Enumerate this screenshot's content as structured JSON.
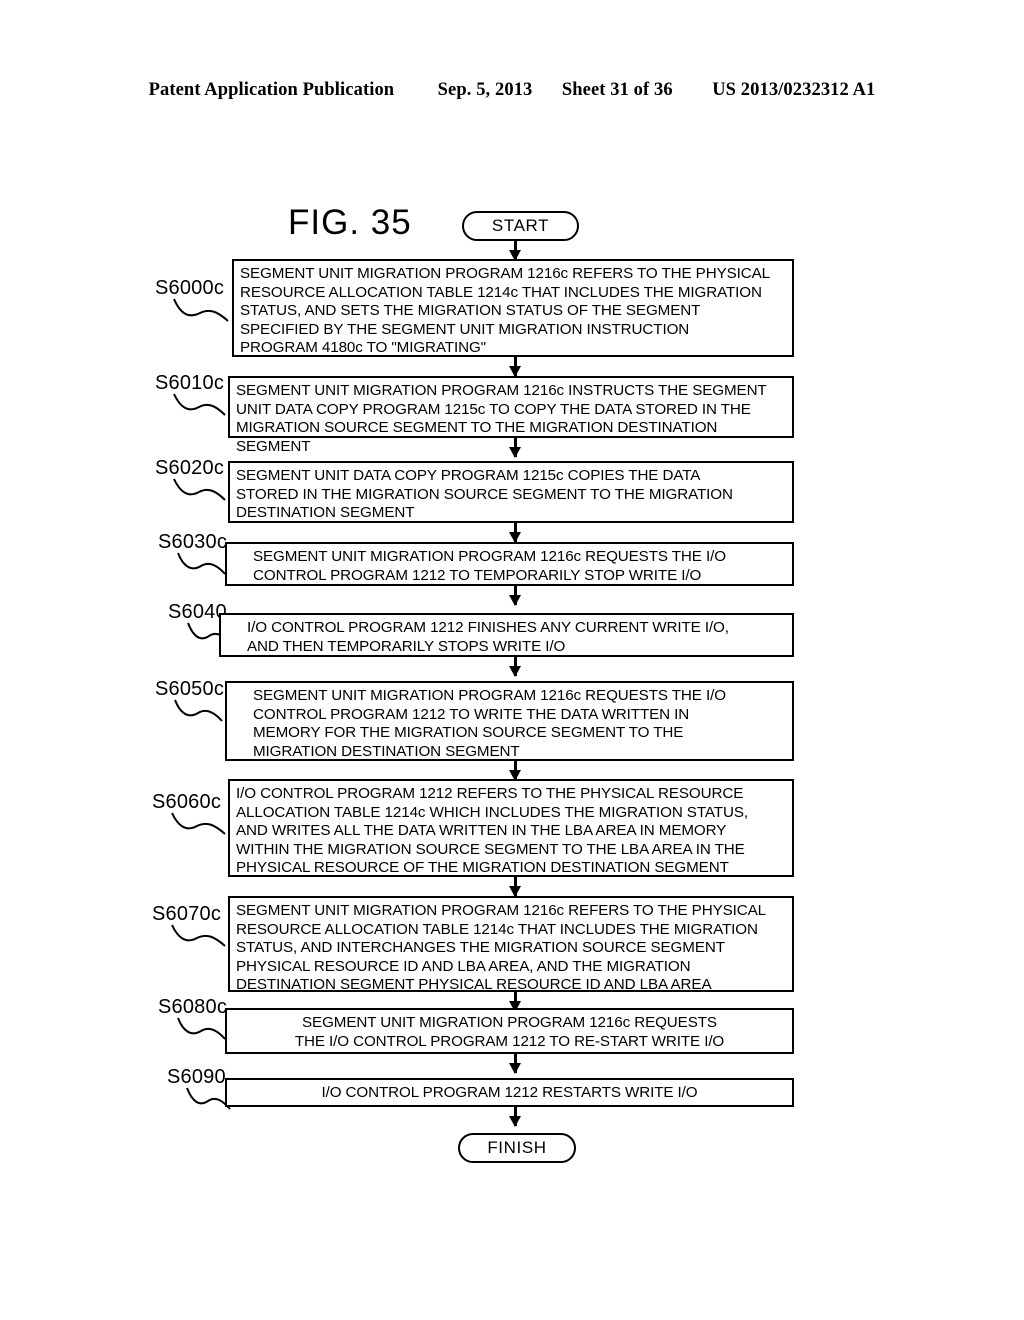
{
  "header": {
    "publication": "Patent Application Publication",
    "date": "Sep. 5, 2013",
    "sheet": "Sheet 31 of 36",
    "number": "US 2013/0232312 A1"
  },
  "figure": {
    "title": "FIG. 35"
  },
  "flow": {
    "start_label": "START",
    "finish_label": "FINISH",
    "steps": [
      {
        "id": "S6000c",
        "text": "SEGMENT UNIT MIGRATION PROGRAM 1216c REFERS TO THE PHYSICAL\nRESOURCE ALLOCATION TABLE 1214c THAT INCLUDES THE MIGRATION\nSTATUS, AND SETS THE MIGRATION STATUS OF THE SEGMENT\nSPECIFIED BY THE SEGMENT UNIT MIGRATION INSTRUCTION\nPROGRAM 4180c TO \"MIGRATING\""
      },
      {
        "id": "S6010c",
        "text": "SEGMENT UNIT MIGRATION PROGRAM 1216c INSTRUCTS THE SEGMENT\nUNIT DATA COPY PROGRAM 1215c TO COPY THE DATA STORED IN THE\nMIGRATION SOURCE SEGMENT TO THE MIGRATION DESTINATION SEGMENT"
      },
      {
        "id": "S6020c",
        "text": "SEGMENT UNIT DATA COPY PROGRAM 1215c COPIES THE DATA\nSTORED IN THE MIGRATION SOURCE SEGMENT TO THE MIGRATION\nDESTINATION SEGMENT"
      },
      {
        "id": "S6030c",
        "text": "SEGMENT UNIT MIGRATION PROGRAM 1216c REQUESTS THE I/O\nCONTROL PROGRAM 1212 TO TEMPORARILY STOP WRITE I/O"
      },
      {
        "id": "S6040",
        "text": "I/O CONTROL PROGRAM 1212 FINISHES ANY CURRENT WRITE I/O,\nAND THEN TEMPORARILY STOPS WRITE I/O"
      },
      {
        "id": "S6050c",
        "text": "SEGMENT UNIT MIGRATION PROGRAM 1216c REQUESTS THE I/O\nCONTROL PROGRAM 1212 TO WRITE THE DATA WRITTEN IN\nMEMORY FOR THE MIGRATION SOURCE SEGMENT TO THE\nMIGRATION DESTINATION SEGMENT"
      },
      {
        "id": "S6060c",
        "text": "I/O CONTROL PROGRAM 1212 REFERS TO THE PHYSICAL RESOURCE\nALLOCATION TABLE 1214c WHICH INCLUDES THE MIGRATION STATUS,\nAND WRITES ALL THE DATA WRITTEN IN THE LBA AREA IN MEMORY\nWITHIN THE MIGRATION SOURCE SEGMENT TO THE LBA AREA IN THE\nPHYSICAL RESOURCE OF THE MIGRATION DESTINATION SEGMENT"
      },
      {
        "id": "S6070c",
        "text": "SEGMENT UNIT MIGRATION PROGRAM 1216c REFERS TO THE PHYSICAL\nRESOURCE ALLOCATION TABLE 1214c THAT INCLUDES THE MIGRATION\nSTATUS, AND INTERCHANGES THE MIGRATION SOURCE SEGMENT\nPHYSICAL RESOURCE ID AND LBA AREA, AND THE MIGRATION\nDESTINATION SEGMENT PHYSICAL RESOURCE ID AND LBA AREA"
      },
      {
        "id": "S6080c",
        "text": "SEGMENT UNIT MIGRATION PROGRAM 1216c REQUESTS\nTHE I/O CONTROL PROGRAM 1212 TO RE-START WRITE I/O"
      },
      {
        "id": "S6090",
        "text": "I/O CONTROL PROGRAM 1212 RESTARTS WRITE I/O"
      }
    ]
  }
}
